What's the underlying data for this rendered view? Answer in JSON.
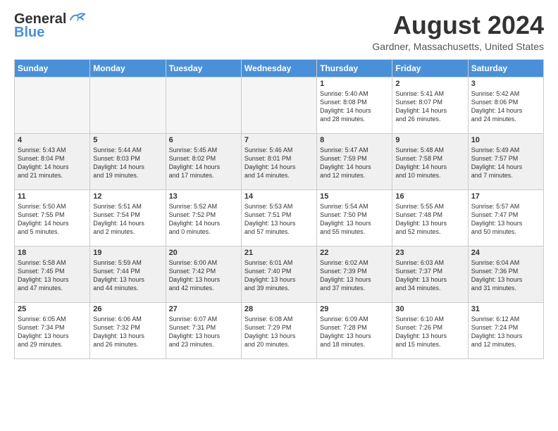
{
  "header": {
    "logo_general": "General",
    "logo_blue": "Blue",
    "month_year": "August 2024",
    "location": "Gardner, Massachusetts, United States"
  },
  "days_of_week": [
    "Sunday",
    "Monday",
    "Tuesday",
    "Wednesday",
    "Thursday",
    "Friday",
    "Saturday"
  ],
  "weeks": [
    {
      "days": [
        {
          "date": "",
          "empty": true
        },
        {
          "date": "",
          "empty": true
        },
        {
          "date": "",
          "empty": true
        },
        {
          "date": "",
          "empty": true
        },
        {
          "date": "1",
          "info": "Sunrise: 5:40 AM\nSunset: 8:08 PM\nDaylight: 14 hours\nand 28 minutes."
        },
        {
          "date": "2",
          "info": "Sunrise: 5:41 AM\nSunset: 8:07 PM\nDaylight: 14 hours\nand 26 minutes."
        },
        {
          "date": "3",
          "info": "Sunrise: 5:42 AM\nSunset: 8:06 PM\nDaylight: 14 hours\nand 24 minutes."
        }
      ]
    },
    {
      "days": [
        {
          "date": "4",
          "info": "Sunrise: 5:43 AM\nSunset: 8:04 PM\nDaylight: 14 hours\nand 21 minutes."
        },
        {
          "date": "5",
          "info": "Sunrise: 5:44 AM\nSunset: 8:03 PM\nDaylight: 14 hours\nand 19 minutes."
        },
        {
          "date": "6",
          "info": "Sunrise: 5:45 AM\nSunset: 8:02 PM\nDaylight: 14 hours\nand 17 minutes."
        },
        {
          "date": "7",
          "info": "Sunrise: 5:46 AM\nSunset: 8:01 PM\nDaylight: 14 hours\nand 14 minutes."
        },
        {
          "date": "8",
          "info": "Sunrise: 5:47 AM\nSunset: 7:59 PM\nDaylight: 14 hours\nand 12 minutes."
        },
        {
          "date": "9",
          "info": "Sunrise: 5:48 AM\nSunset: 7:58 PM\nDaylight: 14 hours\nand 10 minutes."
        },
        {
          "date": "10",
          "info": "Sunrise: 5:49 AM\nSunset: 7:57 PM\nDaylight: 14 hours\nand 7 minutes."
        }
      ]
    },
    {
      "days": [
        {
          "date": "11",
          "info": "Sunrise: 5:50 AM\nSunset: 7:55 PM\nDaylight: 14 hours\nand 5 minutes."
        },
        {
          "date": "12",
          "info": "Sunrise: 5:51 AM\nSunset: 7:54 PM\nDaylight: 14 hours\nand 2 minutes."
        },
        {
          "date": "13",
          "info": "Sunrise: 5:52 AM\nSunset: 7:52 PM\nDaylight: 14 hours\nand 0 minutes."
        },
        {
          "date": "14",
          "info": "Sunrise: 5:53 AM\nSunset: 7:51 PM\nDaylight: 13 hours\nand 57 minutes."
        },
        {
          "date": "15",
          "info": "Sunrise: 5:54 AM\nSunset: 7:50 PM\nDaylight: 13 hours\nand 55 minutes."
        },
        {
          "date": "16",
          "info": "Sunrise: 5:55 AM\nSunset: 7:48 PM\nDaylight: 13 hours\nand 52 minutes."
        },
        {
          "date": "17",
          "info": "Sunrise: 5:57 AM\nSunset: 7:47 PM\nDaylight: 13 hours\nand 50 minutes."
        }
      ]
    },
    {
      "days": [
        {
          "date": "18",
          "info": "Sunrise: 5:58 AM\nSunset: 7:45 PM\nDaylight: 13 hours\nand 47 minutes."
        },
        {
          "date": "19",
          "info": "Sunrise: 5:59 AM\nSunset: 7:44 PM\nDaylight: 13 hours\nand 44 minutes."
        },
        {
          "date": "20",
          "info": "Sunrise: 6:00 AM\nSunset: 7:42 PM\nDaylight: 13 hours\nand 42 minutes."
        },
        {
          "date": "21",
          "info": "Sunrise: 6:01 AM\nSunset: 7:40 PM\nDaylight: 13 hours\nand 39 minutes."
        },
        {
          "date": "22",
          "info": "Sunrise: 6:02 AM\nSunset: 7:39 PM\nDaylight: 13 hours\nand 37 minutes."
        },
        {
          "date": "23",
          "info": "Sunrise: 6:03 AM\nSunset: 7:37 PM\nDaylight: 13 hours\nand 34 minutes."
        },
        {
          "date": "24",
          "info": "Sunrise: 6:04 AM\nSunset: 7:36 PM\nDaylight: 13 hours\nand 31 minutes."
        }
      ]
    },
    {
      "days": [
        {
          "date": "25",
          "info": "Sunrise: 6:05 AM\nSunset: 7:34 PM\nDaylight: 13 hours\nand 29 minutes."
        },
        {
          "date": "26",
          "info": "Sunrise: 6:06 AM\nSunset: 7:32 PM\nDaylight: 13 hours\nand 26 minutes."
        },
        {
          "date": "27",
          "info": "Sunrise: 6:07 AM\nSunset: 7:31 PM\nDaylight: 13 hours\nand 23 minutes."
        },
        {
          "date": "28",
          "info": "Sunrise: 6:08 AM\nSunset: 7:29 PM\nDaylight: 13 hours\nand 20 minutes."
        },
        {
          "date": "29",
          "info": "Sunrise: 6:09 AM\nSunset: 7:28 PM\nDaylight: 13 hours\nand 18 minutes."
        },
        {
          "date": "30",
          "info": "Sunrise: 6:10 AM\nSunset: 7:26 PM\nDaylight: 13 hours\nand 15 minutes."
        },
        {
          "date": "31",
          "info": "Sunrise: 6:12 AM\nSunset: 7:24 PM\nDaylight: 13 hours\nand 12 minutes."
        }
      ]
    }
  ]
}
